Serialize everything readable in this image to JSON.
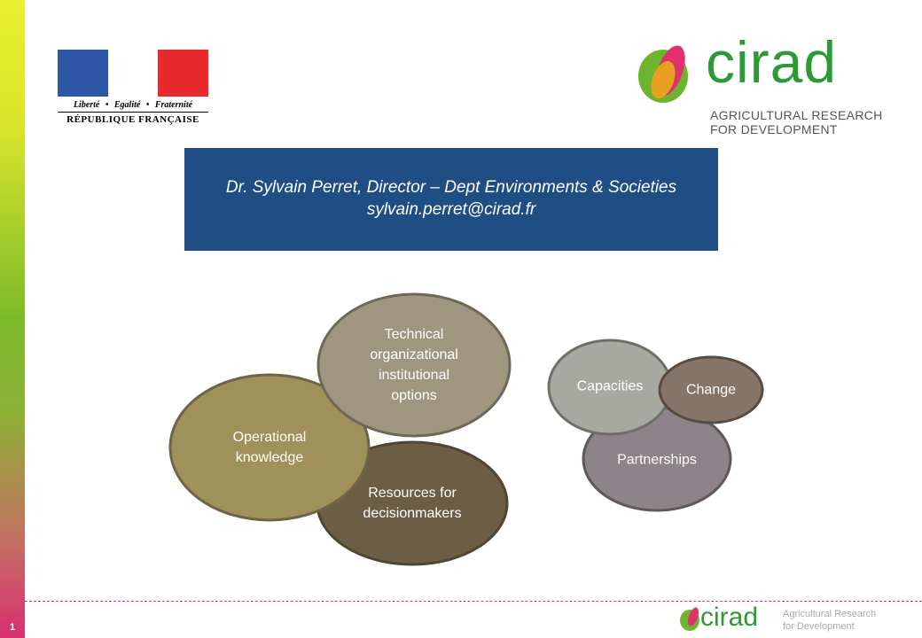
{
  "page_number": "1",
  "logo_left": {
    "motto": "Liberté • Egalité • Fraternité",
    "name": "RÉPUBLIQUE FRANÇAISE"
  },
  "logo_right": {
    "word": "cirad",
    "tagline_1": "AGRICULTURAL RESEARCH",
    "tagline_2": "FOR DEVELOPMENT"
  },
  "banner": {
    "line1": "Dr. Sylvain Perret, Director – Dept Environments & Societies",
    "line2": "sylvain.perret@cirad.fr"
  },
  "diagram_left": [
    {
      "l1": "Resources for",
      "l2": "decisionmakers",
      "color": "#6b5e45"
    },
    {
      "l1": "Operational",
      "l2": "knowledge",
      "color": "#a0905a"
    },
    {
      "l1": "Technical",
      "l2": "organizational",
      "l3": "institutional",
      "l4": "options",
      "color": "#a09680"
    }
  ],
  "diagram_right": [
    {
      "label": "Partnerships",
      "color": "#8c8488"
    },
    {
      "label": "Capacities",
      "color": "#a8a8a2"
    },
    {
      "label": "Change",
      "color": "#857468"
    }
  ],
  "footer": {
    "word": "cirad",
    "tagline_1": "Agricultural Research",
    "tagline_2": "for Development"
  }
}
